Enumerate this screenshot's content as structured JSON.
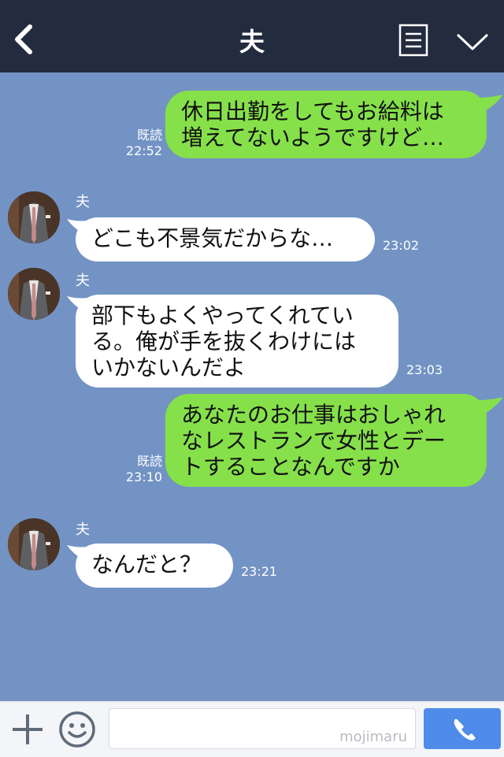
{
  "header": {
    "title": "夫",
    "back_icon": "chevron-left-icon",
    "menu_icon": "list-icon",
    "dropdown_icon": "chevron-down-icon",
    "background": "#232b3e"
  },
  "messages": [
    {
      "direction": "outgoing",
      "text": "休日出勤をしてもお給料は\n増えてないようですけど…",
      "read": "既読",
      "time": "22:52"
    },
    {
      "direction": "incoming",
      "sender": "夫",
      "text": "どこも不景気だからな…",
      "time": "23:02"
    },
    {
      "direction": "incoming",
      "sender": "夫",
      "text": "部下もよくやってくれてい\nる。俺が手を抜くわけには\nいかないんだよ",
      "time": "23:03"
    },
    {
      "direction": "outgoing",
      "text": "あなたのお仕事はおしゃれ\nなレストランで女性とデー\nトすることなんですか",
      "read": "既読",
      "time": "23:10"
    },
    {
      "direction": "incoming",
      "sender": "夫",
      "text": "なんだと？",
      "time": "23:21"
    }
  ],
  "footer": {
    "plus_icon": "plus-icon",
    "emoji_icon": "smiley-icon",
    "input_value": "",
    "watermark": "mojimaru",
    "call_icon": "phone-icon"
  },
  "colors": {
    "chat_background": "#7393c4",
    "outgoing_bubble": "#86e04a",
    "incoming_bubble": "#ffffff",
    "call_button": "#4f8be8"
  }
}
